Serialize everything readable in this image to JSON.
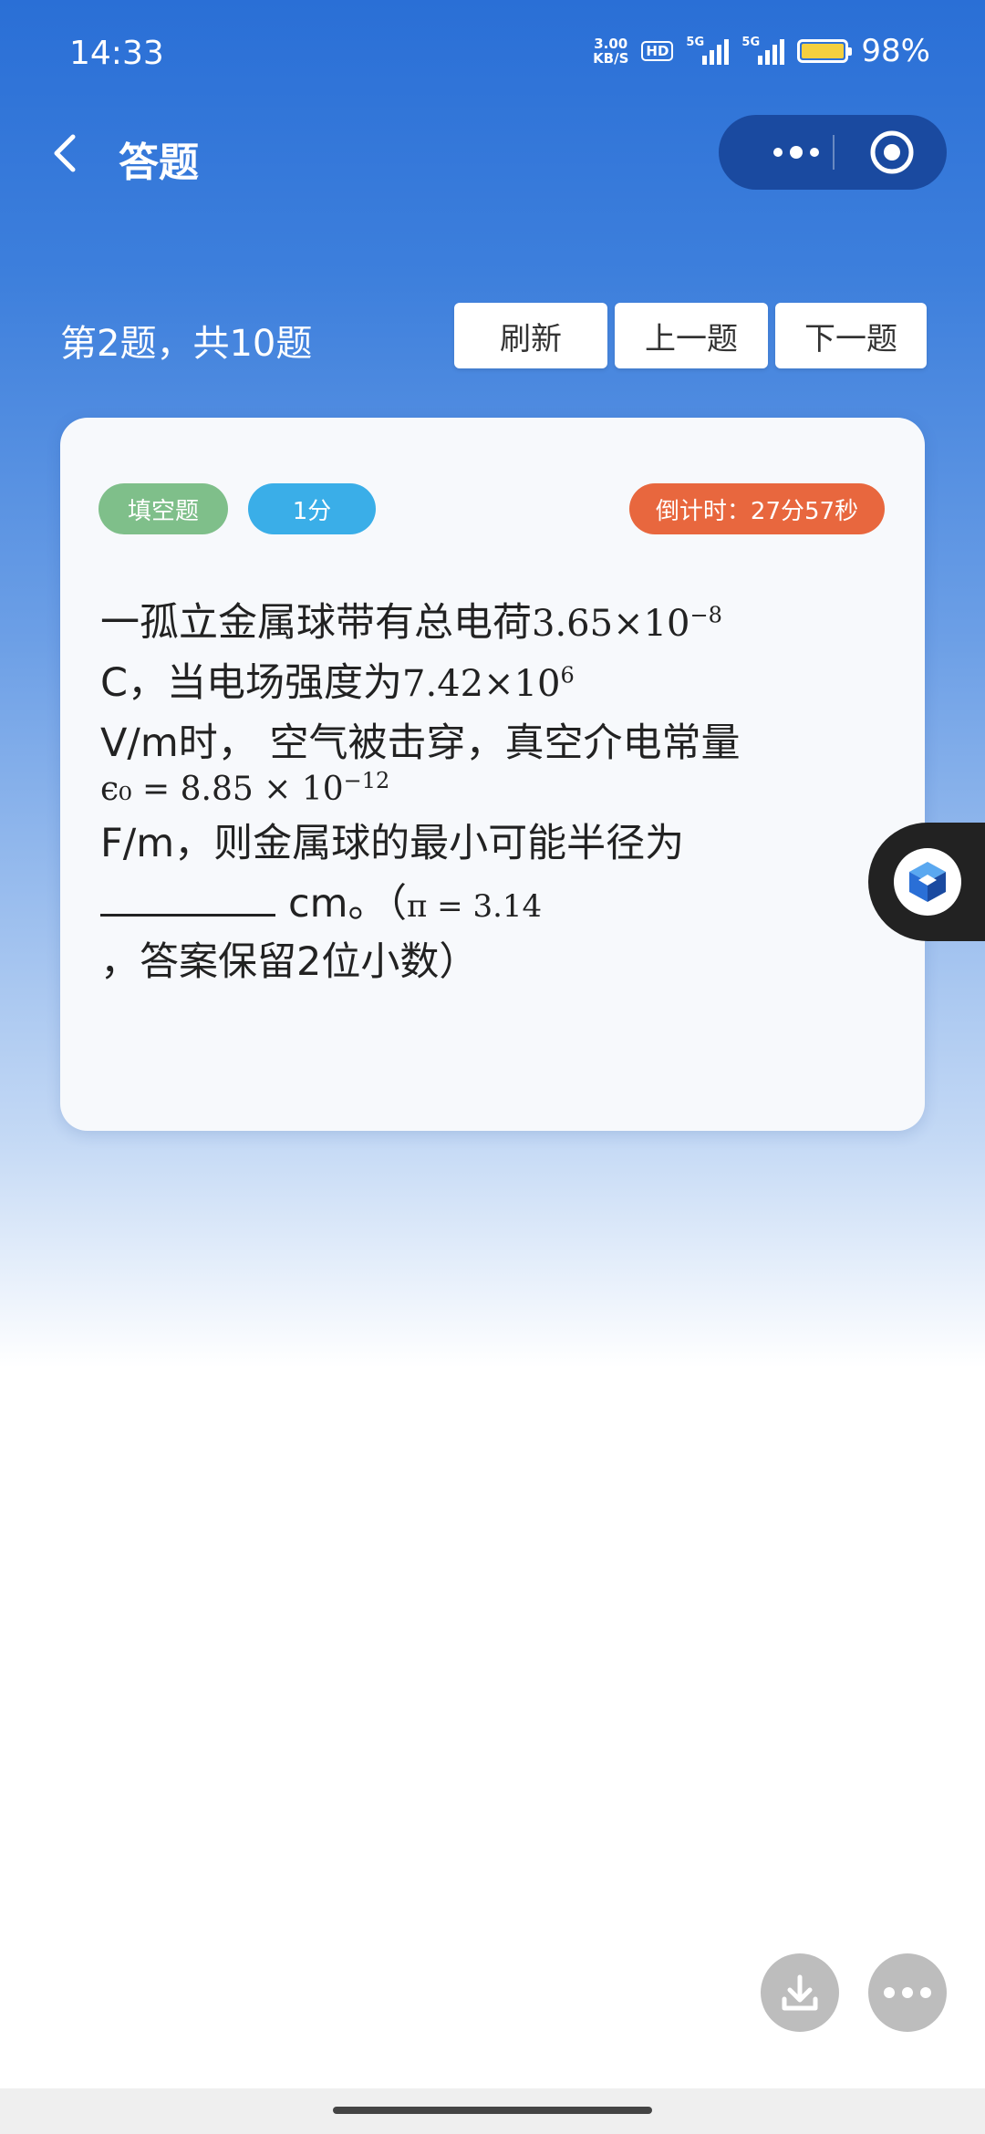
{
  "status_bar": {
    "time": "14:33",
    "net_speed_value": "3.00",
    "net_speed_unit": "KB/S",
    "hd_label": "HD",
    "signal_1_label": "5G",
    "signal_2_label": "5G",
    "battery_percent": "98%",
    "battery_level": 0.98
  },
  "navbar": {
    "title": "答题"
  },
  "header": {
    "progress_text": "第2题，共10题",
    "refresh_label": "刷新",
    "prev_label": "上一题",
    "next_label": "下一题"
  },
  "question_card": {
    "type_badge": "填空题",
    "score_badge": "1分",
    "timer_badge": "倒计时：27分57秒",
    "line1_text": "一孤立金属球带有总电荷",
    "line1_math_base": "3.65×10",
    "line1_math_exp": "−8",
    "line2_text": "C，当电场强度为",
    "line2_math_base": "7.42×10",
    "line2_math_exp": "6",
    "line3_text": "V/m时， 空气被击穿，真空介电常量",
    "line4_math_base": "ϵ₀ = 8.85 × 10",
    "line4_math_exp": "−12",
    "line5_text": "F/m，则金属球的最小可能半径为",
    "line6_text": "cm。（",
    "line6_math": "π = 3.14",
    "line7_text": "，答案保留2位小数）"
  },
  "colors": {
    "header_blue": "#2a6fd6",
    "type_badge": "#7fbf8a",
    "score_badge": "#3aaee8",
    "timer_badge": "#e8673e"
  },
  "icons": {
    "back": "chevron-left-icon",
    "more": "more-dots-icon",
    "close": "target-circle-icon",
    "float": "cube-icon",
    "download": "download-icon",
    "fab_more": "more-dots-icon"
  }
}
